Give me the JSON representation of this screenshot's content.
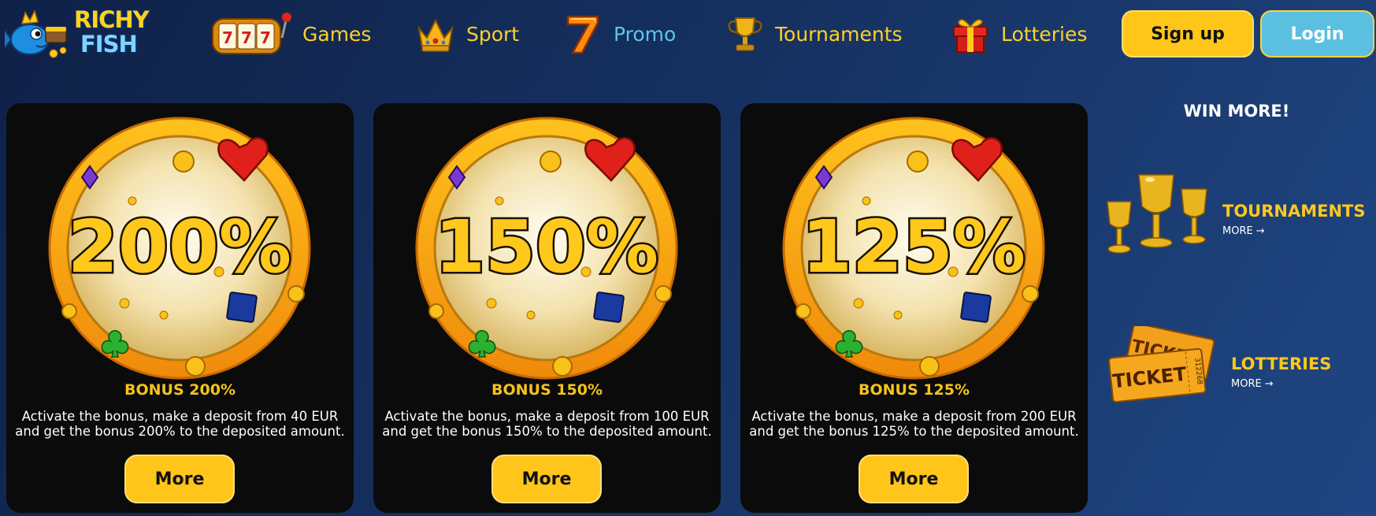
{
  "header": {
    "logo": {
      "line1": "RICHY",
      "line2": "FISH"
    },
    "nav": [
      {
        "label": "Games",
        "icon": "slot-machine-icon"
      },
      {
        "label": "Sport",
        "icon": "crown-icon"
      },
      {
        "label": "Promo",
        "icon": "seven-icon",
        "active": true
      },
      {
        "label": "Tournaments",
        "icon": "trophy-icon"
      },
      {
        "label": "Lotteries",
        "icon": "gift-icon"
      }
    ],
    "signup_label": "Sign up",
    "login_label": "Login"
  },
  "promos": [
    {
      "badge": "200%",
      "title": "BONUS 200%",
      "line1": "Activate the bonus, make a deposit from 40 EUR",
      "line2": "and get the bonus 200% to the deposited amount.",
      "button": "More"
    },
    {
      "badge": "150%",
      "title": "BONUS 150%",
      "line1": "Activate the bonus, make a deposit from 100 EUR",
      "line2": "and get the bonus 150% to the deposited amount.",
      "button": "More"
    },
    {
      "badge": "125%",
      "title": "BONUS 125%",
      "line1": "Activate the bonus, make a deposit from 200 EUR",
      "line2": "and get the bonus 125% to the deposited amount.",
      "button": "More"
    }
  ],
  "sidebar": {
    "heading": "WIN MORE!",
    "tournaments": {
      "title": "TOURNAMENTS",
      "more": "MORE"
    },
    "lotteries": {
      "title": "LOTTERIES",
      "more": "MORE",
      "ticket_text": "TICKET",
      "ticket_number": "312268"
    }
  },
  "colors": {
    "accent_yellow": "#ffc51a",
    "accent_blue": "#5bbfe0",
    "card_bg": "#0b0b0c"
  }
}
